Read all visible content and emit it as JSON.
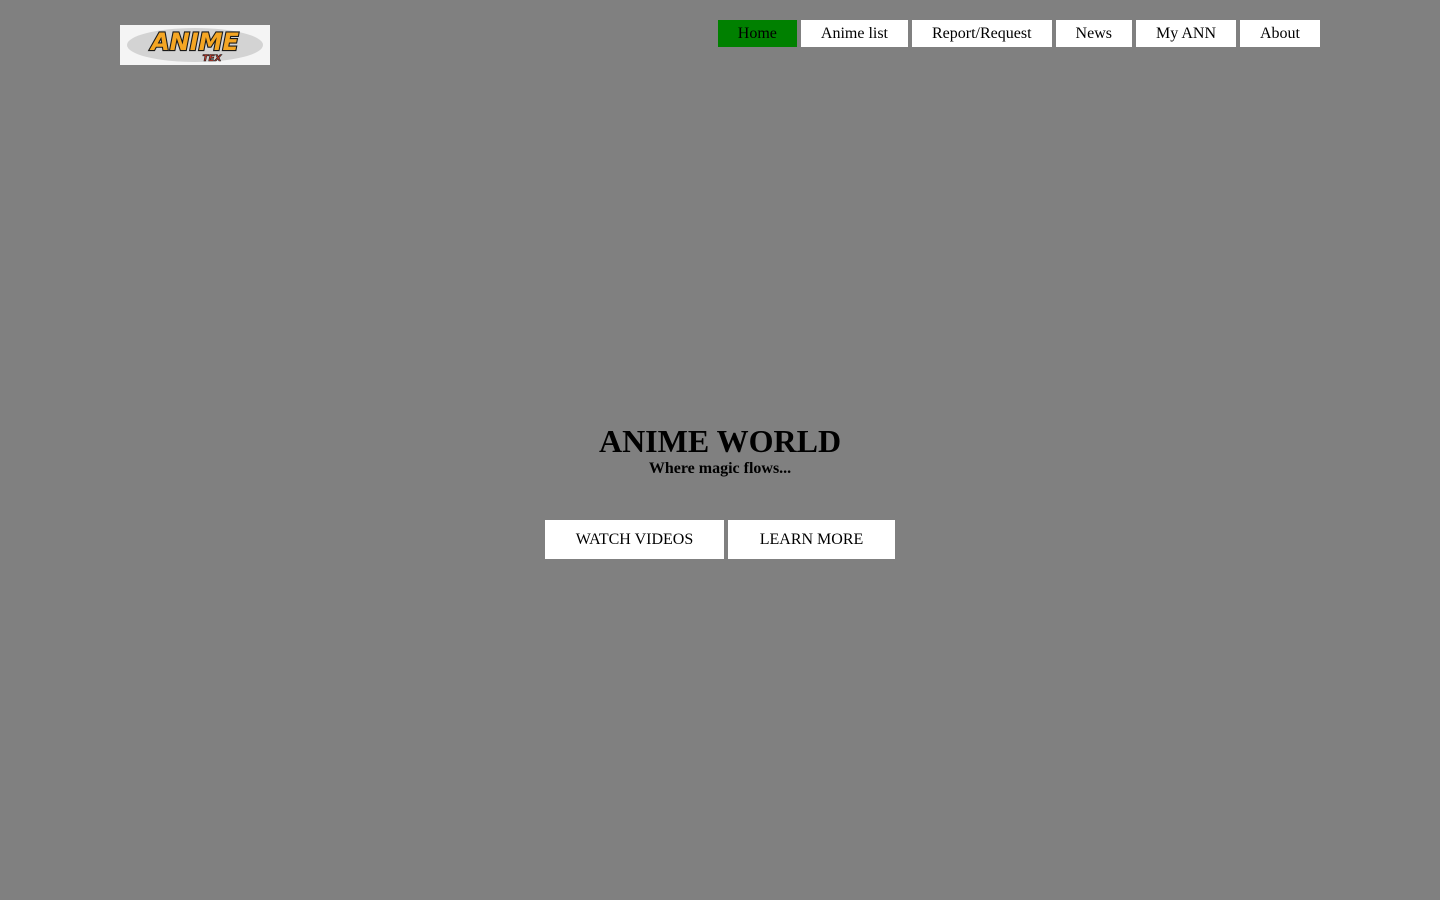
{
  "logo": {
    "text": "ANIME",
    "subtext": "TEX",
    "colors": {
      "fill": "#f5a623",
      "outline": "#1a1a1a",
      "accent": "#c0392b",
      "background": "#f4f4f4"
    }
  },
  "nav": {
    "items": [
      {
        "label": "Home",
        "active": true
      },
      {
        "label": "Anime list",
        "active": false
      },
      {
        "label": "Report/Request",
        "active": false
      },
      {
        "label": "News",
        "active": false
      },
      {
        "label": "My ANN",
        "active": false
      },
      {
        "label": "About",
        "active": false
      }
    ],
    "active_color": "#008000",
    "item_color": "#ffffff"
  },
  "hero": {
    "title": "ANIME WORLD",
    "subtitle": "Where magic flows..."
  },
  "buttons": {
    "watch_label": "WATCH VIDEOS",
    "learn_label": "LEARN MORE"
  },
  "theme": {
    "page_background": "#808080"
  }
}
